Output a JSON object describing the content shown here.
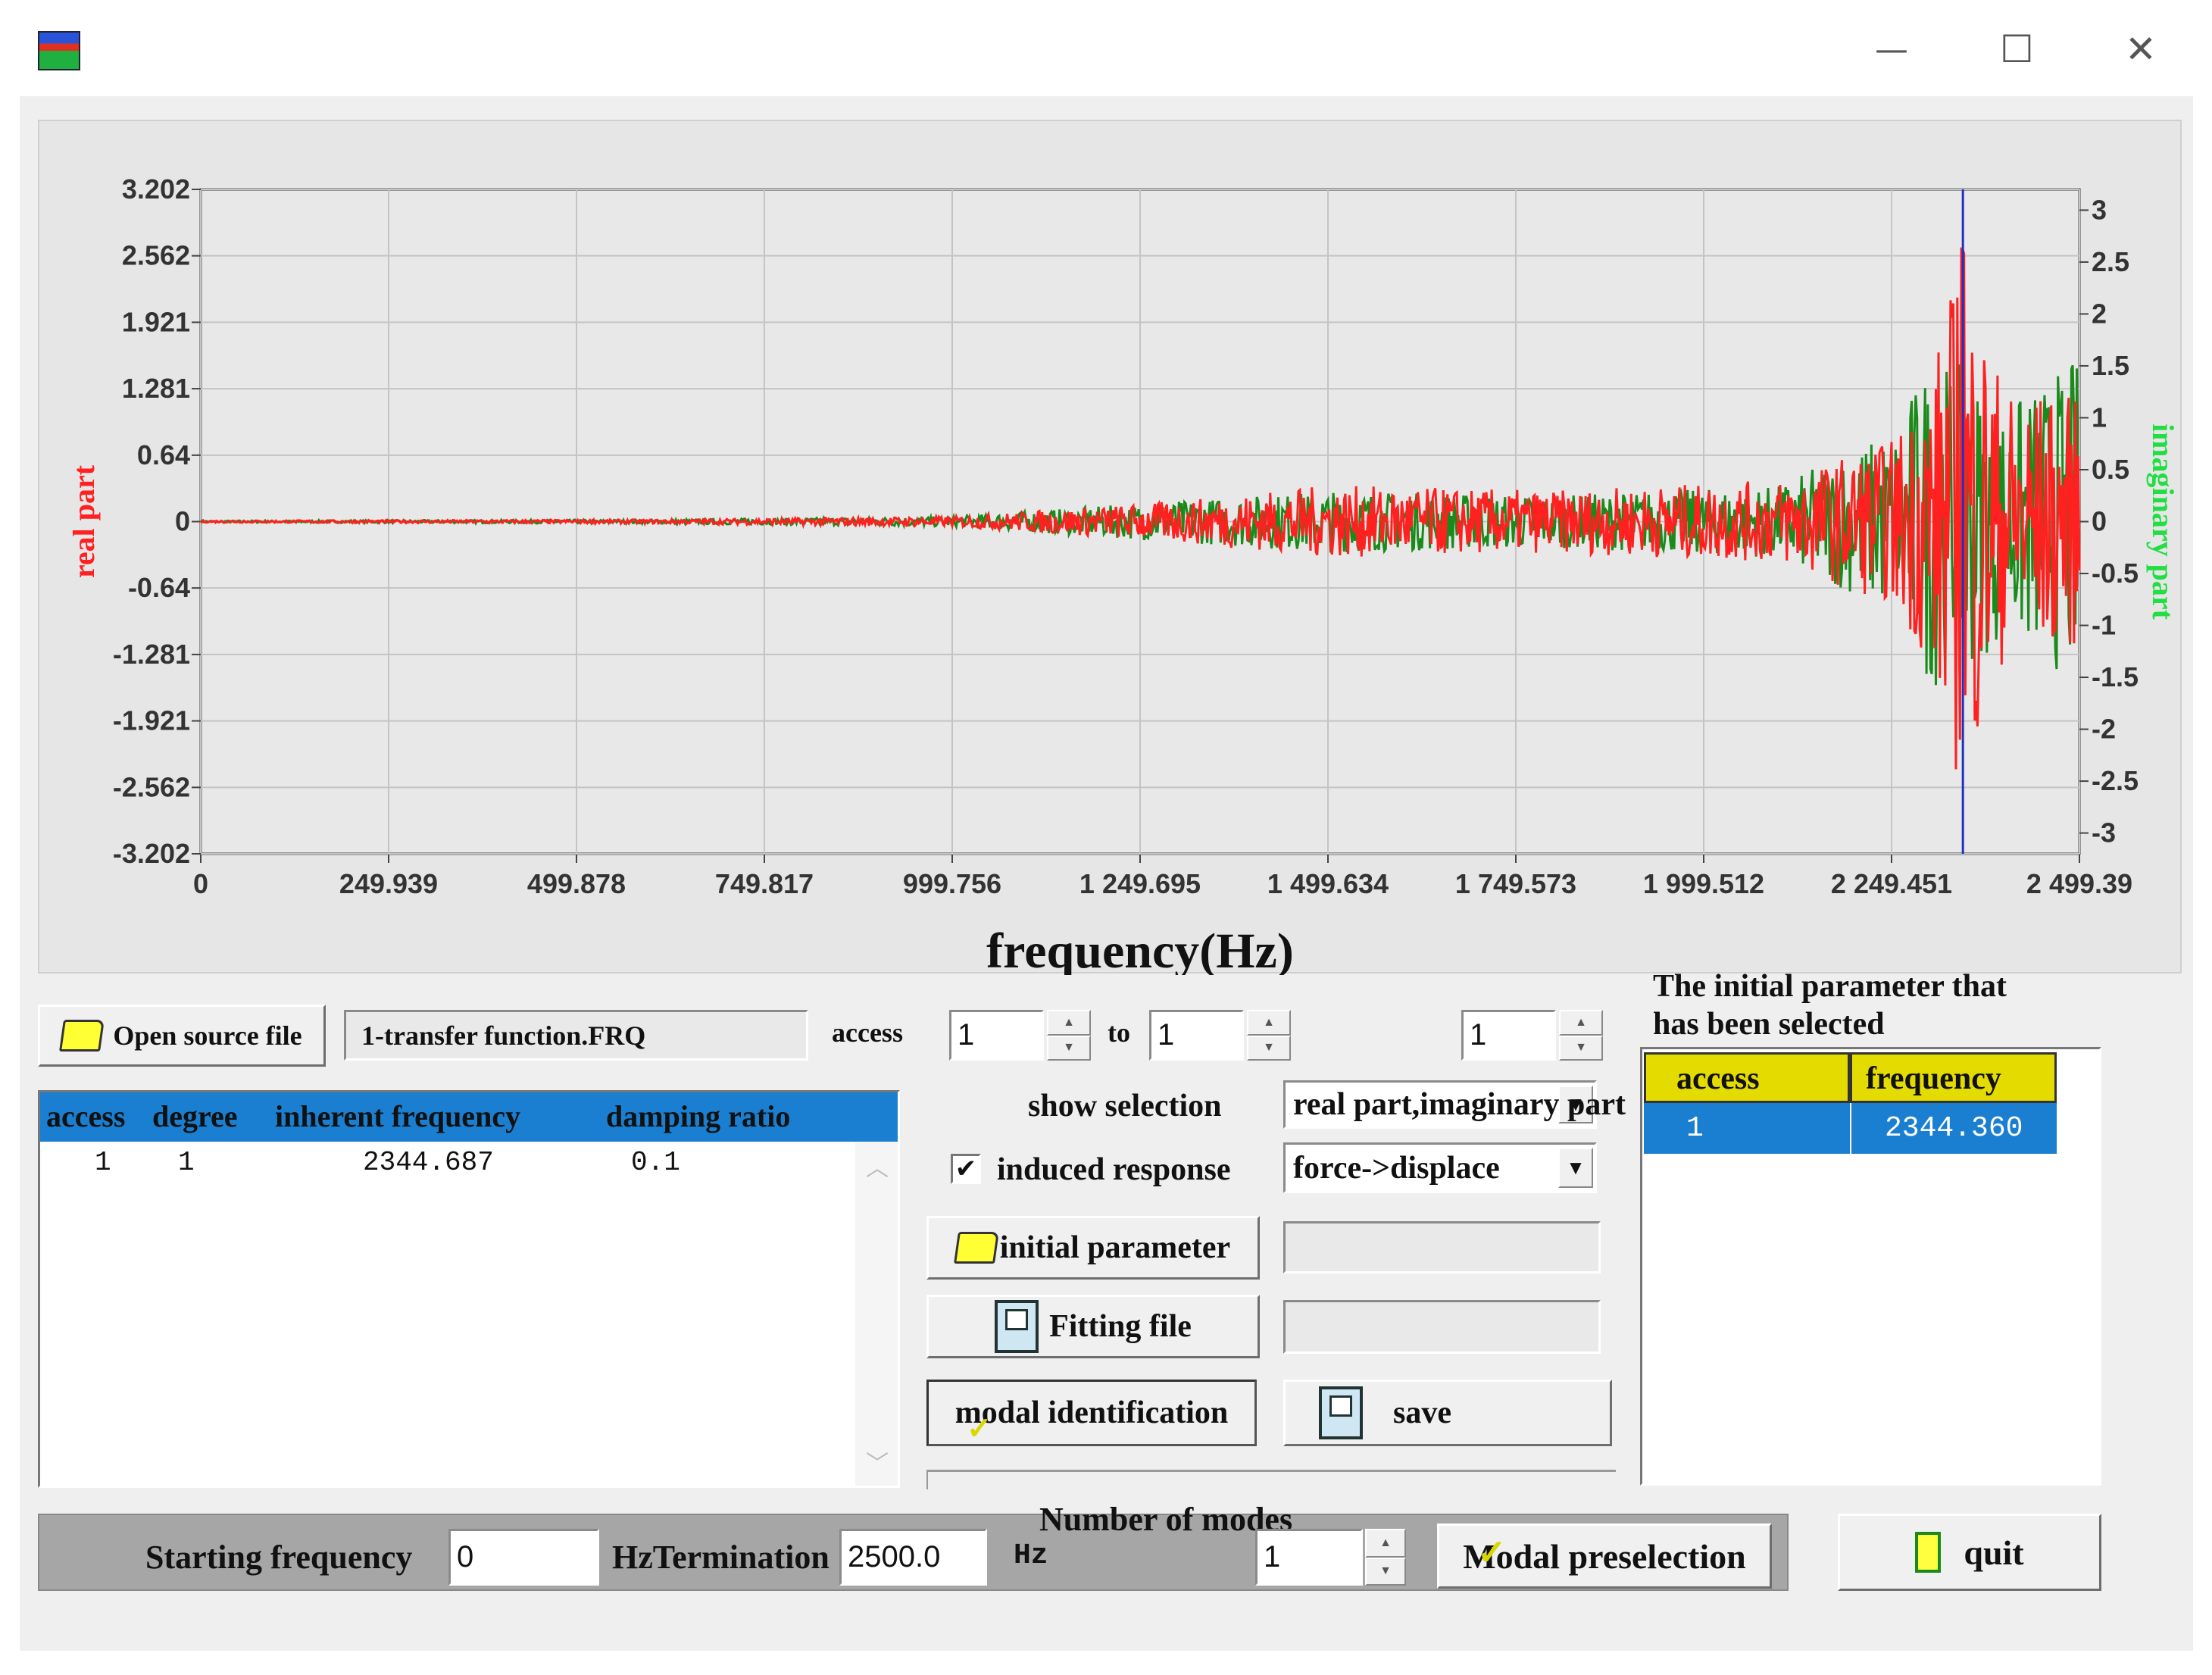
{
  "window": {
    "icon": "fmw-app-icon",
    "minimize": "—",
    "maximize": "☐",
    "close": "✕"
  },
  "chart_data": {
    "type": "line",
    "xlabel": "frequency(Hz)",
    "ylabel_left": "real part",
    "ylabel_right": "imaginary part",
    "xlim": [
      0,
      2499.39
    ],
    "ylim_left": [
      -3.202,
      3.202
    ],
    "ylim_right": [
      -3.2,
      3.2
    ],
    "x_ticks": [
      "0",
      "249.939",
      "499.878",
      "749.817",
      "999.756",
      "1 249.695",
      "1 499.634",
      "1 749.573",
      "1 999.512",
      "2 249.451",
      "2 499.39"
    ],
    "x_tick_values": [
      0,
      249.939,
      499.878,
      749.817,
      999.756,
      1249.695,
      1499.634,
      1749.573,
      1999.512,
      2249.451,
      2499.39
    ],
    "y_left_ticks": [
      "3.202",
      "2.562",
      "1.921",
      "1.281",
      "0.64",
      "0",
      "-0.64",
      "-1.281",
      "-1.921",
      "-2.562",
      "-3.202"
    ],
    "y_left_tick_values": [
      3.202,
      2.562,
      1.921,
      1.281,
      0.64,
      0,
      -0.64,
      -1.281,
      -1.921,
      -2.562,
      -3.202
    ],
    "y_right_ticks": [
      "3",
      "2.5",
      "2",
      "1.5",
      "1",
      "0.5",
      "0",
      "-0.5",
      "-1",
      "-1.5",
      "-2",
      "-2.5",
      "-3"
    ],
    "y_right_tick_values": [
      3,
      2.5,
      2,
      1.5,
      1,
      0.5,
      0,
      -0.5,
      -1,
      -1.5,
      -2,
      -2.5,
      -3
    ],
    "grid": true,
    "marker_frequency": 2344.36,
    "series": [
      {
        "name": "real part",
        "color": "#ff2020",
        "envelope": [
          [
            0,
            0.01
          ],
          [
            600,
            0.02
          ],
          [
            1000,
            0.05
          ],
          [
            1300,
            0.2
          ],
          [
            1500,
            0.35
          ],
          [
            1800,
            0.3
          ],
          [
            2100,
            0.4
          ],
          [
            2250,
            0.8
          ],
          [
            2300,
            1.4
          ],
          [
            2343,
            2.65
          ],
          [
            2400,
            1.3
          ],
          [
            2499,
            1.2
          ]
        ]
      },
      {
        "name": "imaginary part",
        "color": "#1a8a1a",
        "envelope": [
          [
            0,
            0.01
          ],
          [
            600,
            0.02
          ],
          [
            1000,
            0.05
          ],
          [
            1300,
            0.2
          ],
          [
            1500,
            0.3
          ],
          [
            1800,
            0.25
          ],
          [
            2100,
            0.35
          ],
          [
            2250,
            0.9
          ],
          [
            2300,
            1.6
          ],
          [
            2343,
            1.5
          ],
          [
            2400,
            1.1
          ],
          [
            2499,
            1.6
          ]
        ]
      }
    ]
  },
  "source": {
    "open_label": "Open source file",
    "file_name": "1-transfer function.FRQ"
  },
  "access": {
    "label": "access",
    "from": "1",
    "to_label": "to",
    "to": "1",
    "extra": "1"
  },
  "modes_table": {
    "headers": [
      "access",
      "degree",
      "inherent frequency",
      "damping ratio"
    ],
    "rows": [
      [
        "1",
        "1",
        "2344.687",
        "0.1"
      ]
    ]
  },
  "display": {
    "show_selection_label": "show selection",
    "show_selection_value": "real part,imaginary part",
    "induced_response_label": "induced response",
    "induced_response_checked": true,
    "induced_response_value": "force->displace"
  },
  "buttons": {
    "initial_parameter": "initial parameter",
    "fitting_file": "Fitting file",
    "modal_identification": "modal identification",
    "save": "save",
    "modal_preselection": "Modal preselection",
    "quit": "quit"
  },
  "selected": {
    "title_line1": "The initial parameter that",
    "title_line2": "has been selected",
    "headers": [
      "access",
      "frequency"
    ],
    "rows": [
      [
        "1",
        "2344.360"
      ]
    ]
  },
  "bottom": {
    "start_label": "Starting frequency",
    "start_value": "0",
    "termination_label": "HzTermination",
    "termination_value": "2500.0",
    "hz_label": "Hz",
    "modes_label": "Number of modes",
    "modes_value": "1"
  }
}
